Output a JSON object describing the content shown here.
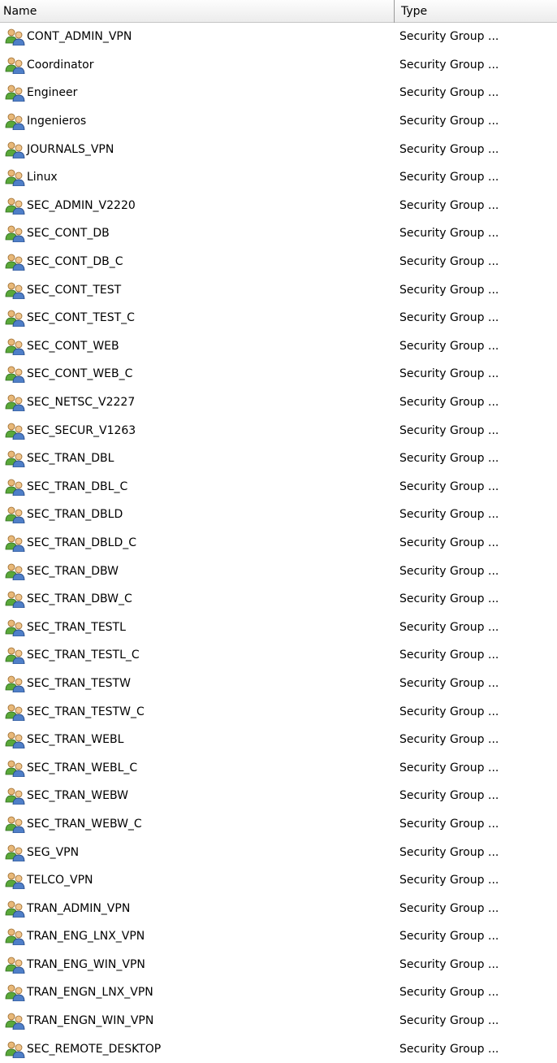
{
  "columns": {
    "name": "Name",
    "type": "Type"
  },
  "icon": "security-group-icon",
  "rows": [
    {
      "name": "CONT_ADMIN_VPN",
      "type": "Security Group ..."
    },
    {
      "name": "Coordinator",
      "type": "Security Group ..."
    },
    {
      "name": "Engineer",
      "type": "Security Group ..."
    },
    {
      "name": "Ingenieros",
      "type": "Security Group ..."
    },
    {
      "name": "JOURNALS_VPN",
      "type": "Security Group ..."
    },
    {
      "name": "Linux",
      "type": "Security Group ..."
    },
    {
      "name": "SEC_ADMIN_V2220",
      "type": "Security Group ..."
    },
    {
      "name": "SEC_CONT_DB",
      "type": "Security Group ..."
    },
    {
      "name": "SEC_CONT_DB_C",
      "type": "Security Group ..."
    },
    {
      "name": "SEC_CONT_TEST",
      "type": "Security Group ..."
    },
    {
      "name": "SEC_CONT_TEST_C",
      "type": "Security Group ..."
    },
    {
      "name": "SEC_CONT_WEB",
      "type": "Security Group ..."
    },
    {
      "name": "SEC_CONT_WEB_C",
      "type": "Security Group ..."
    },
    {
      "name": "SEC_NETSC_V2227",
      "type": "Security Group ..."
    },
    {
      "name": "SEC_SECUR_V1263",
      "type": "Security Group ..."
    },
    {
      "name": "SEC_TRAN_DBL",
      "type": "Security Group ..."
    },
    {
      "name": "SEC_TRAN_DBL_C",
      "type": "Security Group ..."
    },
    {
      "name": "SEC_TRAN_DBLD",
      "type": "Security Group ..."
    },
    {
      "name": "SEC_TRAN_DBLD_C",
      "type": "Security Group ..."
    },
    {
      "name": "SEC_TRAN_DBW",
      "type": "Security Group ..."
    },
    {
      "name": "SEC_TRAN_DBW_C",
      "type": "Security Group ..."
    },
    {
      "name": "SEC_TRAN_TESTL",
      "type": "Security Group ..."
    },
    {
      "name": "SEC_TRAN_TESTL_C",
      "type": "Security Group ..."
    },
    {
      "name": "SEC_TRAN_TESTW",
      "type": "Security Group ..."
    },
    {
      "name": "SEC_TRAN_TESTW_C",
      "type": "Security Group ..."
    },
    {
      "name": "SEC_TRAN_WEBL",
      "type": "Security Group ..."
    },
    {
      "name": "SEC_TRAN_WEBL_C",
      "type": "Security Group ..."
    },
    {
      "name": "SEC_TRAN_WEBW",
      "type": "Security Group ..."
    },
    {
      "name": "SEC_TRAN_WEBW_C",
      "type": "Security Group ..."
    },
    {
      "name": "SEG_VPN",
      "type": "Security Group ..."
    },
    {
      "name": "TELCO_VPN",
      "type": "Security Group ..."
    },
    {
      "name": "TRAN_ADMIN_VPN",
      "type": "Security Group ..."
    },
    {
      "name": "TRAN_ENG_LNX_VPN",
      "type": "Security Group ..."
    },
    {
      "name": "TRAN_ENG_WIN_VPN",
      "type": "Security Group ..."
    },
    {
      "name": "TRAN_ENGN_LNX_VPN",
      "type": "Security Group ..."
    },
    {
      "name": "TRAN_ENGN_WIN_VPN",
      "type": "Security Group ..."
    },
    {
      "name": "SEC_REMOTE_DESKTOP",
      "type": "Security Group ..."
    }
  ]
}
